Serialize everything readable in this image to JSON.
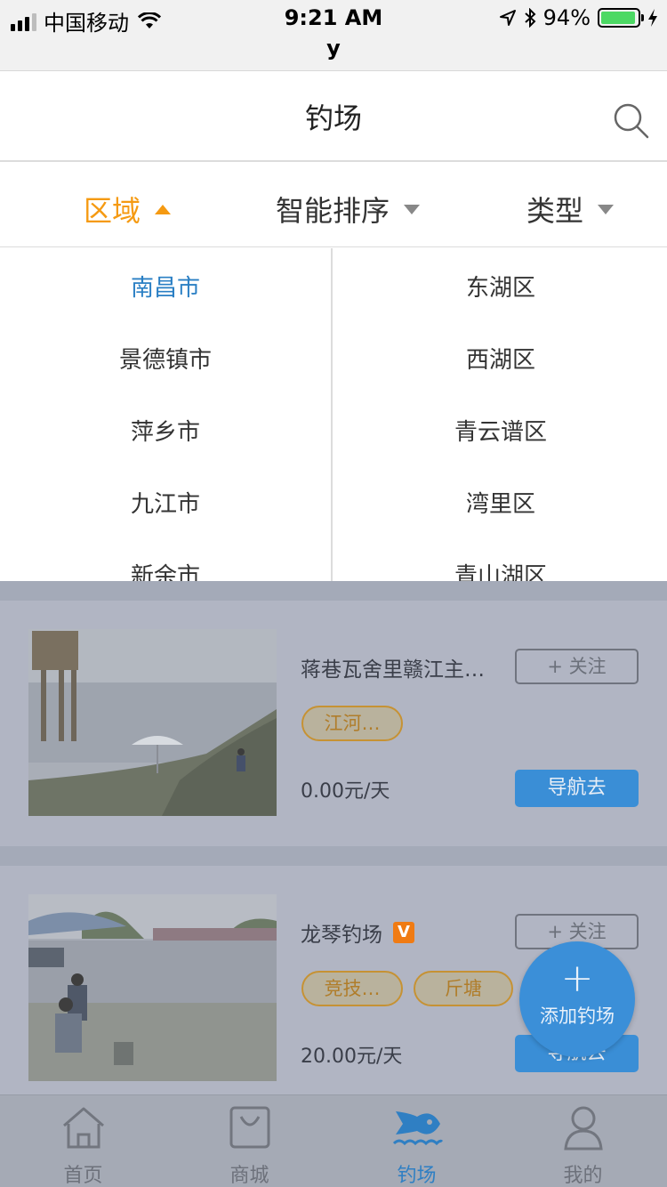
{
  "status_bar": {
    "carrier": "中国移动",
    "time": "9:21 AM",
    "sub": "y",
    "battery": "94%",
    "battery_level": 0.94
  },
  "header": {
    "title": "钓场",
    "search_icon": "search-icon"
  },
  "filters": [
    {
      "label": "区域",
      "active": true
    },
    {
      "label": "智能排序",
      "active": false
    },
    {
      "label": "类型",
      "active": false
    }
  ],
  "dropdown": {
    "cities": [
      "南昌市",
      "景德镇市",
      "萍乡市",
      "九江市",
      "新余市"
    ],
    "selected_city": "南昌市",
    "districts": [
      "东湖区",
      "西湖区",
      "青云谱区",
      "湾里区",
      "青山湖区"
    ]
  },
  "cards": [
    {
      "title": "蒋巷瓦舍里赣江主…",
      "verified": false,
      "tags": [
        "江河…"
      ],
      "price": "0.00元/天",
      "follow_label": "+ 关注",
      "nav_label": "导航去"
    },
    {
      "title": "龙琴钓场",
      "verified": true,
      "verified_badge": "V",
      "tags": [
        "竞技…",
        "斤塘"
      ],
      "price": "20.00元/天",
      "follow_label": "+ 关注",
      "nav_label": "导航去"
    }
  ],
  "fab": {
    "plus": "+",
    "label": "添加钓场"
  },
  "tabbar": [
    {
      "label": "首页",
      "icon": "home-icon",
      "active": false
    },
    {
      "label": "商城",
      "icon": "shopping-bag-icon",
      "active": false
    },
    {
      "label": "钓场",
      "icon": "fish-icon",
      "active": true
    },
    {
      "label": "我的",
      "icon": "user-icon",
      "active": false
    }
  ],
  "colors": {
    "accent_orange": "#f59a12",
    "selected_blue": "#2a7fc4",
    "button_blue": "#3a8ed6"
  }
}
